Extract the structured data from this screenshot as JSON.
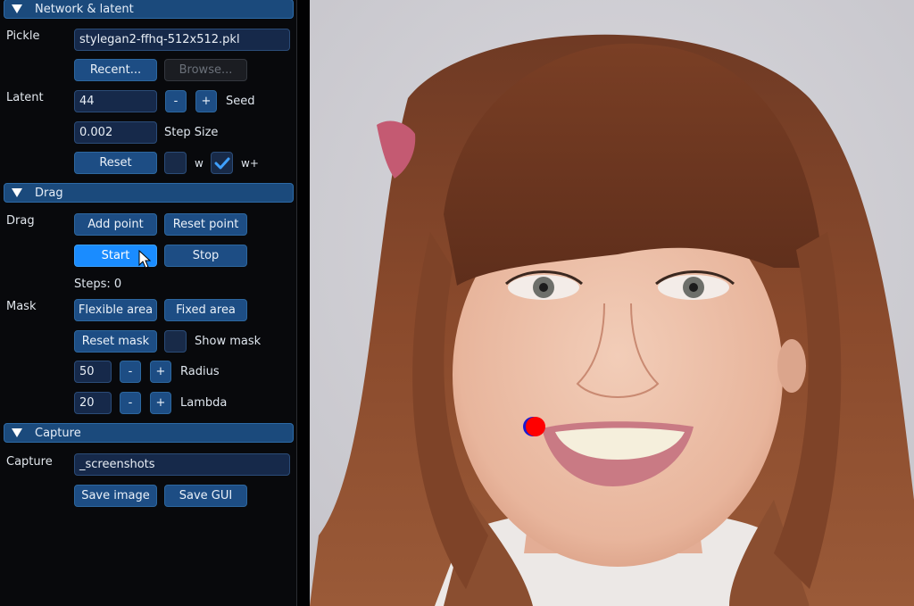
{
  "sections": {
    "network": {
      "title": "Network & latent",
      "pickle_label": "Pickle",
      "pickle_value": "stylegan2-ffhq-512x512.pkl",
      "recent_button": "Recent...",
      "browse_button": "Browse...",
      "latent_label": "Latent",
      "seed_value": "44",
      "minus": "-",
      "plus": "+",
      "seed_label": "Seed",
      "step_size_value": "0.002",
      "step_size_label": "Step Size",
      "reset_button": "Reset",
      "w_label": "w",
      "w_checked": false,
      "wplus_label": "w+",
      "wplus_checked": true
    },
    "drag": {
      "title": "Drag",
      "drag_label": "Drag",
      "add_point_button": "Add point",
      "reset_point_button": "Reset point",
      "start_button": "Start",
      "stop_button": "Stop",
      "steps_text": "Steps: 0",
      "mask_label": "Mask",
      "flexible_area_button": "Flexible area",
      "fixed_area_button": "Fixed area",
      "reset_mask_button": "Reset mask",
      "show_mask_label": "Show mask",
      "show_mask_checked": false,
      "radius_value": "50",
      "radius_label": "Radius",
      "lambda_value": "20",
      "lambda_label": "Lambda",
      "minus": "-",
      "plus": "+"
    },
    "capture": {
      "title": "Capture",
      "capture_label": "Capture",
      "capture_value": "_screenshots",
      "save_image_button": "Save image",
      "save_gui_button": "Save GUI"
    }
  },
  "image_view": {
    "description": "Generated portrait: smiling woman with long auburn hair and bangs",
    "handle_point_color": "#ff0000",
    "target_point_color": "#0000cc"
  },
  "colors": {
    "accent": "#1a8cff",
    "button": "#1d4d84",
    "header": "#1b4a7c",
    "panel_bg": "#08090c"
  }
}
